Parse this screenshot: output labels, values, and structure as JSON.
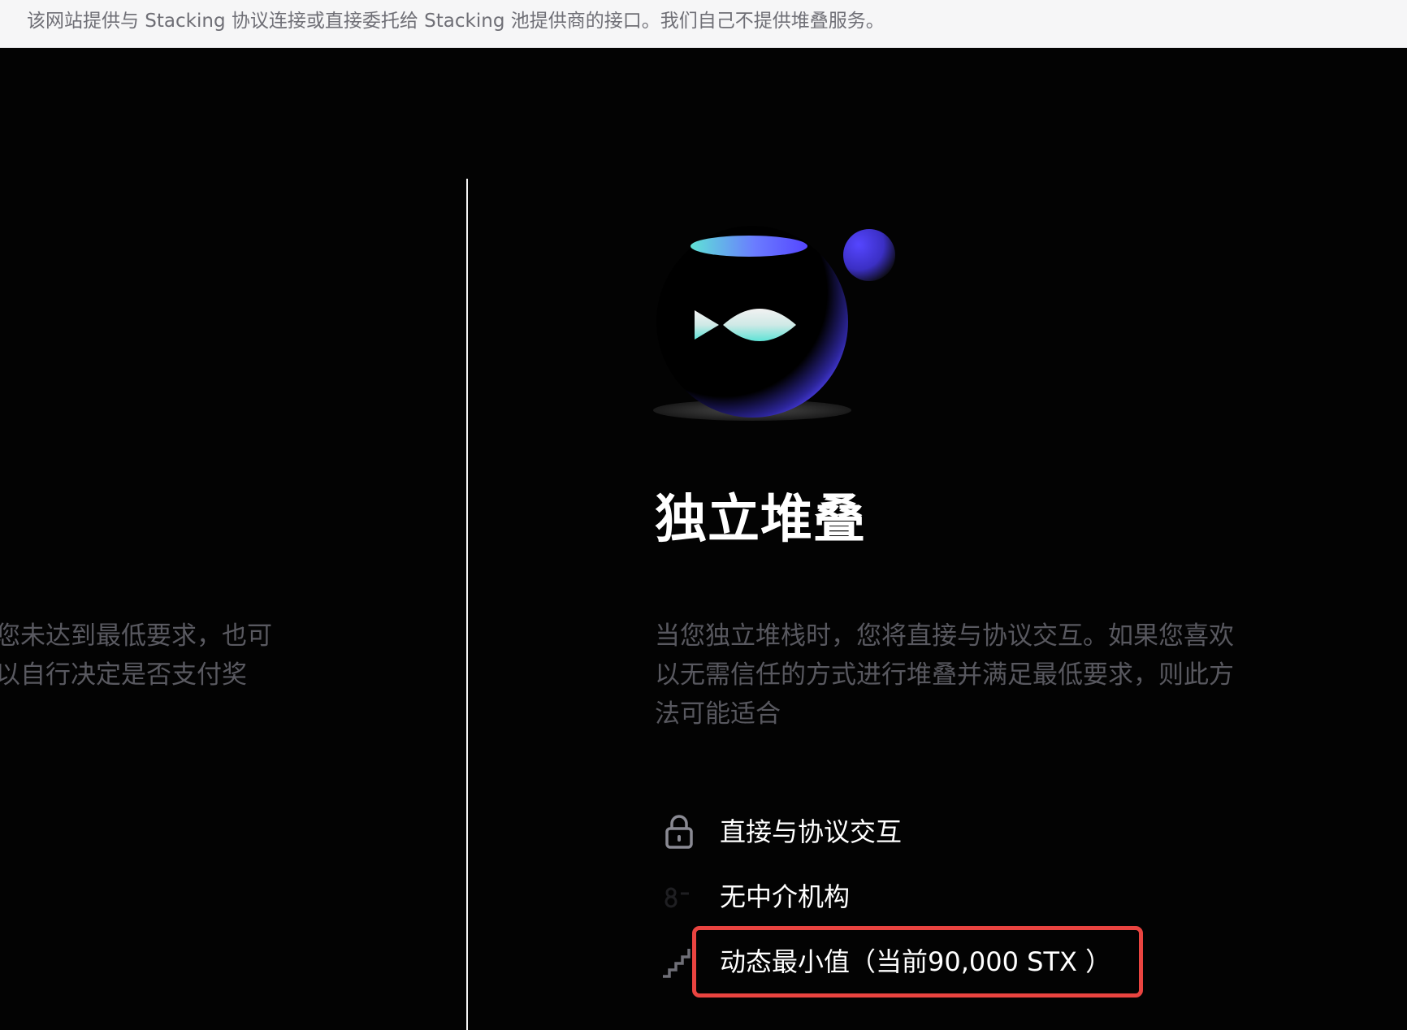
{
  "banner": {
    "text": "该网站提供与 Stacking 协议连接或直接委托给 Stacking 池提供商的接口。我们自己不提供堆叠服务。"
  },
  "left_panel": {
    "description_lines": [
      "您未达到最低要求，也可",
      "以自行决定是否支付奖"
    ]
  },
  "right_panel": {
    "illustration_icon": "stacking-orb-illustration",
    "title": "独立堆叠",
    "description_lines": [
      "当您独立堆栈时，您将直接与协议交互。如果您喜欢",
      "以无需信任的方式进行堆叠并满足最低要求，则此方",
      "法可能适合"
    ],
    "features": [
      {
        "icon": "lock-icon",
        "label": "直接与协议交互"
      },
      {
        "icon": "no-intermediary-icon",
        "label": "无中介机构"
      },
      {
        "icon": "stairs-icon",
        "label": "动态最小值（当前90,000 STX ）"
      }
    ]
  },
  "colors": {
    "background": "#030303",
    "banner_background": "#f6f6f7",
    "highlight": "#ea4440",
    "accent_purple": "#5546ff",
    "accent_cyan": "#5fe3d6"
  }
}
